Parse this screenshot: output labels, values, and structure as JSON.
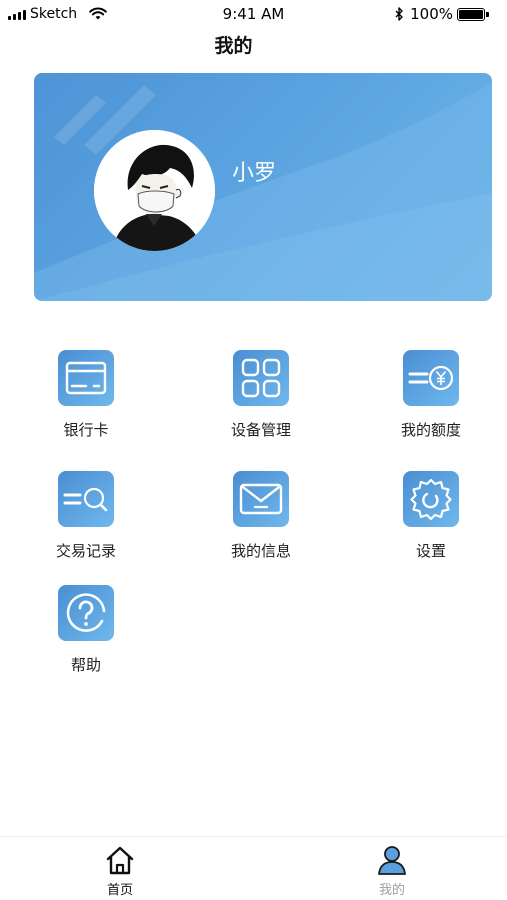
{
  "status_bar": {
    "carrier": "Sketch",
    "time": "9:41 AM",
    "battery": "100%"
  },
  "header": {
    "title": "我的"
  },
  "profile": {
    "username": "小罗",
    "card_color": "#5aa3e0"
  },
  "menu": {
    "items": [
      {
        "label": "银行卡",
        "icon": "bank-card-icon"
      },
      {
        "label": "设备管理",
        "icon": "device-grid-icon"
      },
      {
        "label": "我的额度",
        "icon": "credit-limit-icon"
      },
      {
        "label": "交易记录",
        "icon": "transaction-search-icon"
      },
      {
        "label": "我的信息",
        "icon": "message-envelope-icon"
      },
      {
        "label": "设置",
        "icon": "settings-gear-icon"
      },
      {
        "label": "帮助",
        "icon": "help-question-icon"
      }
    ]
  },
  "tab_bar": {
    "tabs": [
      {
        "label": "首页",
        "icon": "home-icon"
      },
      {
        "label": "我的",
        "icon": "user-icon"
      }
    ]
  }
}
